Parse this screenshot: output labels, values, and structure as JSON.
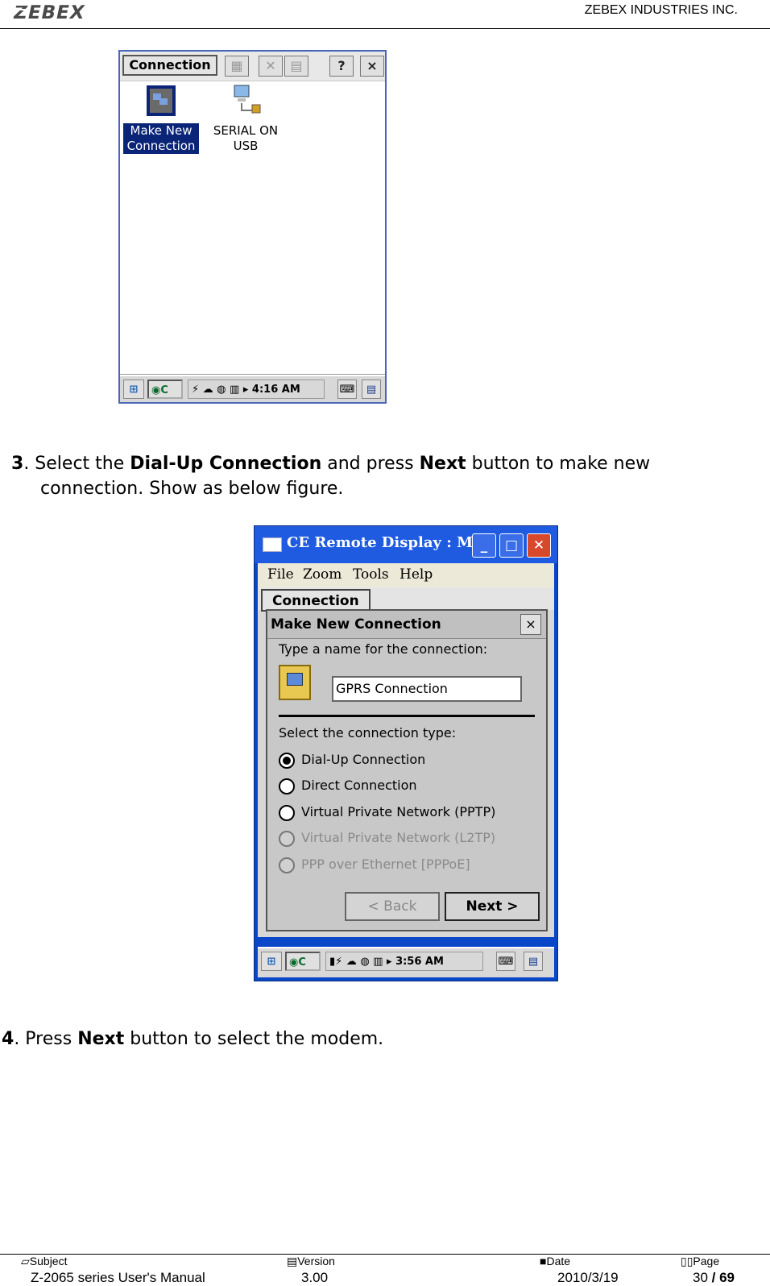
{
  "header": {
    "logo": "ZEBEX",
    "company": "ZEBEX INDUSTRIES INC."
  },
  "screenshot1": {
    "tab_label": "Connection",
    "toolbar": [
      "?",
      "×"
    ],
    "icons": [
      {
        "name": "make-new-connection",
        "label_line1": "Make New",
        "label_line2": "Connection",
        "selected": true
      },
      {
        "name": "serial-on-usb",
        "label_line1": "SERIAL ON",
        "label_line2": "USB",
        "selected": false
      }
    ],
    "taskbar": {
      "ie_label": "C",
      "time": "4:16 AM"
    }
  },
  "step3": {
    "number": "3",
    "text_a": ". Select the ",
    "bold_a": "Dial-Up Connection",
    "text_b": " and press ",
    "bold_b": "Next",
    "text_c": " button to make new",
    "line2": "connection. Show as below figure."
  },
  "screenshot2": {
    "window_title": "CE Remote Display : M...",
    "menu": [
      "File",
      "Zoom",
      "Tools",
      "Help"
    ],
    "tab_label": "Connection",
    "dialog": {
      "title": "Make New Connection",
      "close": "×",
      "name_prompt": "Type a name for the connection:",
      "name_value": "GPRS Connection",
      "type_prompt": "Select the connection type:",
      "options": [
        {
          "label": "Dial-Up Connection",
          "selected": true,
          "enabled": true
        },
        {
          "label": "Direct Connection",
          "selected": false,
          "enabled": true
        },
        {
          "label": "Virtual Private Network (PPTP)",
          "selected": false,
          "enabled": true
        },
        {
          "label": "Virtual Private Network (L2TP)",
          "selected": false,
          "enabled": false
        },
        {
          "label": "PPP over Ethernet [PPPoE]",
          "selected": false,
          "enabled": false
        }
      ],
      "back_button": "< Back",
      "next_button": "Next >"
    },
    "taskbar": {
      "ie_label": "C",
      "time": "3:56 AM"
    }
  },
  "step4": {
    "number": "4",
    "text_a": ". Press ",
    "bold_a": "Next",
    "text_b": " button to select the modem."
  },
  "footer": {
    "subject_label": "Subject",
    "subject_value": "Z-2065 series User's Manual",
    "version_label": "Version",
    "version_value": "3.00",
    "date_label": "Date",
    "date_value": "2010/3/19",
    "page_label": "Page",
    "page_current": "30",
    "page_sep": " / ",
    "page_total": "69"
  }
}
